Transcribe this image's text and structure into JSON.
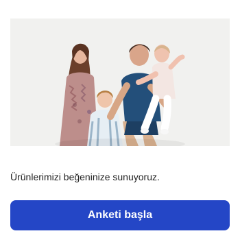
{
  "hero": {
    "image_subject": "family-photo"
  },
  "survey": {
    "message": "Ürünlerimizi beğeninize sunuyoruz.",
    "start_label": "Anketi başla"
  },
  "colors": {
    "button_bg": "#2446c6",
    "button_text": "#ffffff",
    "photo_bg": "#f4f4f2"
  }
}
